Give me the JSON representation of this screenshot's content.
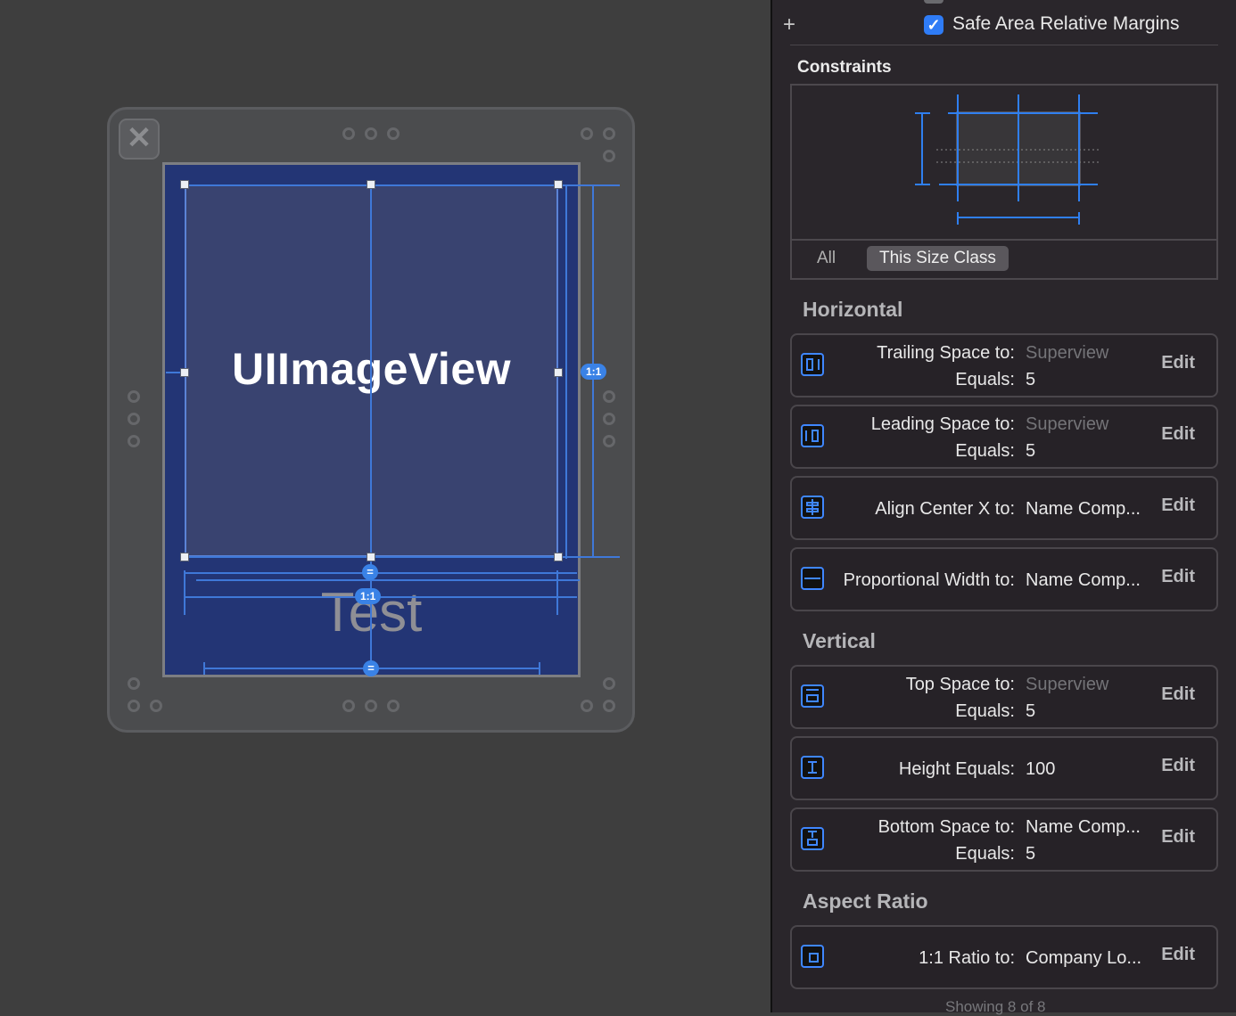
{
  "inspector": {
    "safe_area_label": "Safe Area Relative Margins",
    "constraints_title": "Constraints",
    "segments": [
      "All",
      "This Size Class"
    ],
    "groups": {
      "horizontal": "Horizontal",
      "vertical": "Vertical",
      "aspect": "Aspect Ratio"
    },
    "rows": [
      {
        "label1": "Trailing Space to:",
        "value1": "Superview",
        "label2": "Equals:",
        "value2": "5",
        "edit": "Edit",
        "icon": "trailing-space-icon"
      },
      {
        "label1": "Leading Space to:",
        "value1": "Superview",
        "label2": "Equals:",
        "value2": "5",
        "edit": "Edit",
        "icon": "leading-space-icon"
      },
      {
        "label1": "Align Center X to:",
        "value1": "Name Comp...",
        "edit": "Edit",
        "icon": "align-center-x-icon"
      },
      {
        "label1": "Proportional Width to:",
        "value1": "Name Comp...",
        "edit": "Edit",
        "icon": "proportional-width-icon"
      },
      {
        "label1": "Top Space to:",
        "value1": "Superview",
        "label2": "Equals:",
        "value2": "5",
        "edit": "Edit",
        "icon": "top-space-icon"
      },
      {
        "label1": "Height Equals:",
        "value1": "100",
        "edit": "Edit",
        "icon": "height-icon"
      },
      {
        "label1": "Bottom Space to:",
        "value1": "Name Comp...",
        "label2": "Equals:",
        "value2": "5",
        "edit": "Edit",
        "icon": "bottom-space-icon"
      },
      {
        "label1": "1:1 Ratio to:",
        "value1": "Company Lo...",
        "edit": "Edit",
        "icon": "aspect-ratio-icon"
      }
    ],
    "footer": "Showing 8 of 8"
  },
  "canvas": {
    "imageview_label": "UIImageView",
    "test_label": "Test",
    "ratio_badge": "1:1",
    "equal_badge": "="
  },
  "colors": {
    "accent": "#3a82e6",
    "content_bg": "#233575",
    "imageview_bg": "#394370",
    "inspector_bg": "#2a262b"
  }
}
